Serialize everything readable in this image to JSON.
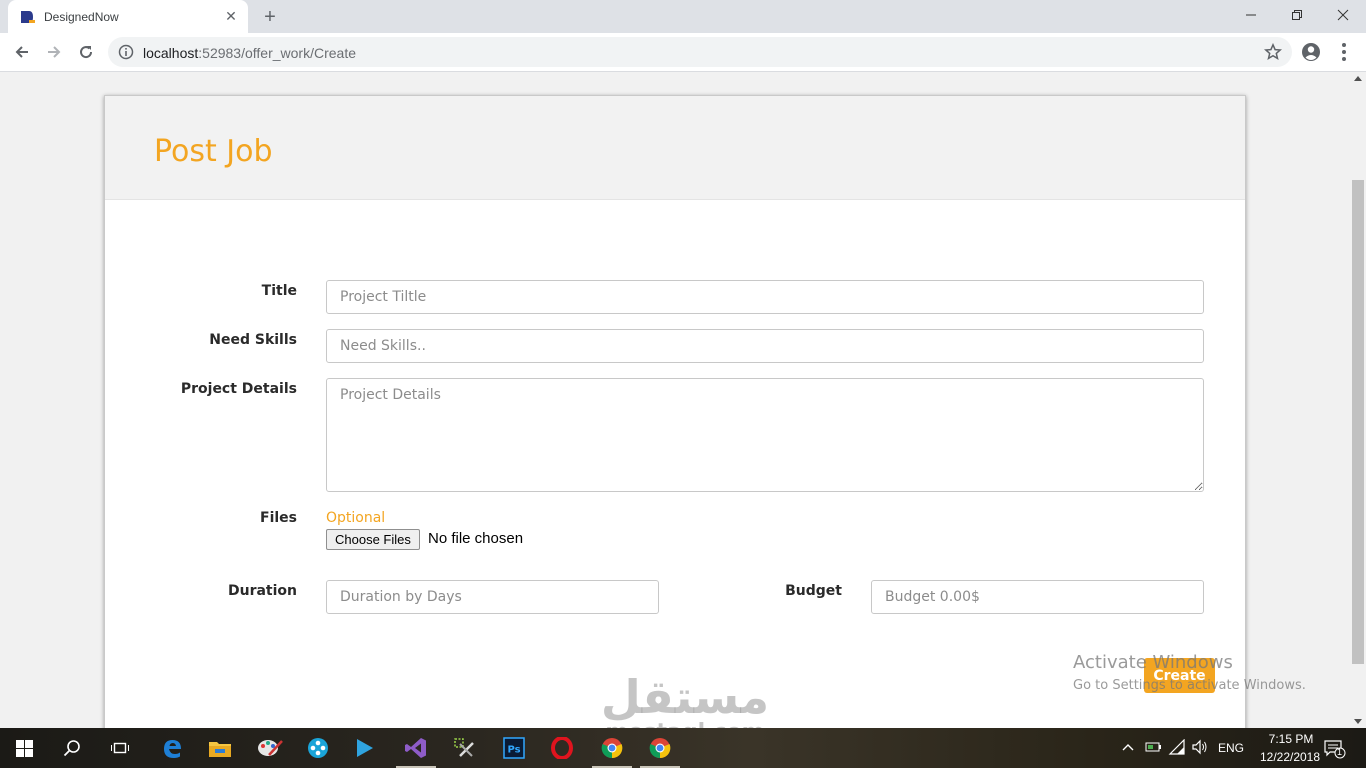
{
  "browser": {
    "tab_title": "DesignedNow",
    "new_tab_symbol": "+",
    "close_tab_symbol": "✕",
    "url_host": "localhost",
    "url_rest": ":52983/offer_work/Create"
  },
  "page": {
    "title": "Post Job",
    "accent_color": "#f3a521"
  },
  "form": {
    "title": {
      "label": "Title",
      "placeholder": "Project Tiltle"
    },
    "skills": {
      "label": "Need Skills",
      "placeholder": "Need Skills.."
    },
    "details": {
      "label": "Project Details",
      "placeholder": "Project Details"
    },
    "files": {
      "label": "Files",
      "hint": "Optional",
      "button": "Choose Files",
      "status": "No file chosen"
    },
    "duration": {
      "label": "Duration",
      "placeholder": "Duration by Days"
    },
    "budget": {
      "label": "Budget",
      "placeholder": "Budget 0.00$"
    },
    "submit_label": "Create"
  },
  "overlays": {
    "activate_line1": "Activate Windows",
    "activate_line2": "Go to Settings to activate Windows.",
    "watermark_arabic": "مستقل",
    "watermark_latin": "mostaql.com"
  },
  "taskbar": {
    "language": "ENG",
    "time": "7:15 PM",
    "date": "12/22/2018",
    "notification_count": "1",
    "apps": [
      "windows-start-icon",
      "search-icon",
      "task-view-icon",
      "edge-icon",
      "file-explorer-icon",
      "paint-icon",
      "media-icon",
      "player-icon",
      "visual-studio-icon",
      "tools-icon",
      "photoshop-icon",
      "opera-icon",
      "chrome-icon",
      "chrome-icon"
    ]
  }
}
